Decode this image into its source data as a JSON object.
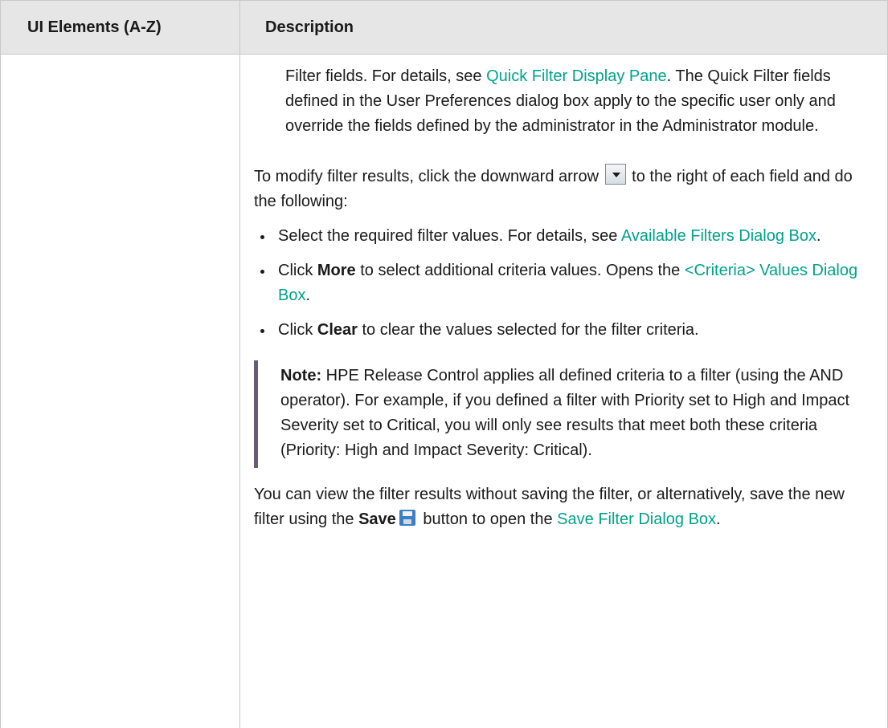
{
  "table": {
    "header": {
      "col1": "UI Elements (A-Z)",
      "col2": "Description"
    }
  },
  "content": {
    "intro": {
      "text1": "Filter fields. For details, see ",
      "link1": "Quick Filter Display Pane",
      "text2": ". The Quick Filter fields defined in the User Preferences dialog box apply to the specific user only and override the fields defined by the administrator in the Administrator module."
    },
    "modify": {
      "before": "To modify filter results, click the downward arrow ",
      "after": " to the right of each field and do the following:"
    },
    "bullets": [
      {
        "pre": "Select the required filter values. For details, see ",
        "link": "Available Filters Dialog Box",
        "post": "."
      },
      {
        "pre": "Click ",
        "bold": "More",
        "mid": " to select additional criteria values. Opens the ",
        "link": "<Criteria> Values Dialog Box",
        "post": "."
      },
      {
        "pre": "Click ",
        "bold": "Clear",
        "post": " to clear the values selected for the filter criteria."
      }
    ],
    "note": {
      "label": "Note:",
      "text": "  HPE Release Control applies all defined criteria to a filter (using the AND operator). For example, if you defined a filter with Priority set to High and Impact Severity set to Critical, you will only see results that meet both these criteria (Priority: High and Impact Severity: Critical)."
    },
    "save": {
      "text1": "You can view the filter results without saving the filter, or alternatively, save the new filter using the ",
      "bold": "Save",
      "text2": " button to open the ",
      "link": "Save Filter Dialog Box",
      "text3": "."
    }
  },
  "colors": {
    "link": "#00a28a",
    "header_bg": "#e6e6e6",
    "note_bar": "#6b5a73"
  },
  "icons": [
    "dropdown-arrow-icon",
    "save-icon"
  ]
}
